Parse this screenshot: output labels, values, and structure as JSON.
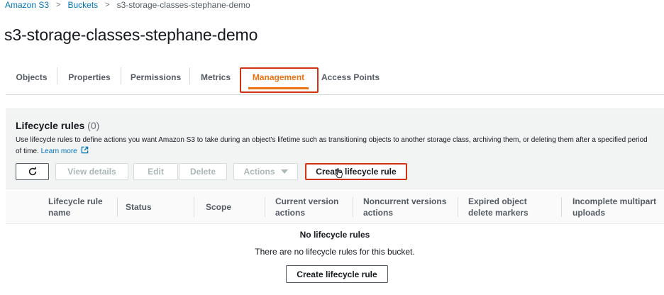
{
  "breadcrumb": {
    "items": [
      "Amazon S3",
      "Buckets",
      "s3-storage-classes-stephane-demo"
    ]
  },
  "page_title": "s3-storage-classes-stephane-demo",
  "tabs": [
    {
      "label": "Objects",
      "active": false
    },
    {
      "label": "Properties",
      "active": false
    },
    {
      "label": "Permissions",
      "active": false
    },
    {
      "label": "Metrics",
      "active": false
    },
    {
      "label": "Management",
      "active": true
    },
    {
      "label": "Access Points",
      "active": false
    }
  ],
  "lifecycle": {
    "title": "Lifecycle rules",
    "count": "(0)",
    "description": "Use lifecycle rules to define actions you want Amazon S3 to take during an object's lifetime such as transitioning objects to another storage class, archiving them, or deleting them after a specified period of time.",
    "learn_more": "Learn more",
    "toolbar": {
      "view_details": "View details",
      "edit": "Edit",
      "delete": "Delete",
      "actions": "Actions",
      "create": "Create lifecycle rule"
    },
    "columns": [
      {
        "line1": "Lifecycle rule",
        "line2": "name"
      },
      {
        "line1": "Status",
        "line2": ""
      },
      {
        "line1": "Scope",
        "line2": ""
      },
      {
        "line1": "Current version",
        "line2": "actions"
      },
      {
        "line1": "Noncurrent versions",
        "line2": "actions"
      },
      {
        "line1": "Expired object",
        "line2": "delete markers"
      },
      {
        "line1": "Incomplete multipart",
        "line2": "uploads"
      }
    ],
    "empty": {
      "title": "No lifecycle rules",
      "description": "There are no lifecycle rules for this bucket.",
      "button": "Create lifecycle rule"
    }
  },
  "colors": {
    "link": "#0073bb",
    "active_tab": "#ec7211",
    "highlight": "#d13212"
  }
}
